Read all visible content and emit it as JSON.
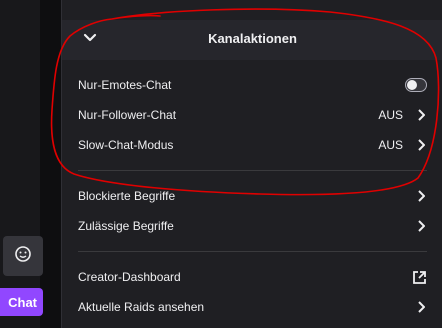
{
  "left": {
    "chat_button_label": "Chat"
  },
  "panel": {
    "header_title": "Kanalaktionen",
    "rows": [
      {
        "label": "Nur-Emotes-Chat",
        "type": "toggle",
        "on": false
      },
      {
        "label": "Nur-Follower-Chat",
        "value": "AUS",
        "type": "chevron"
      },
      {
        "label": "Slow-Chat-Modus",
        "value": "AUS",
        "type": "chevron"
      },
      {
        "label": "Blockierte Begriffe",
        "type": "chevron"
      },
      {
        "label": "Zulässige Begriffe",
        "type": "chevron"
      },
      {
        "label": "Creator-Dashboard",
        "type": "external"
      },
      {
        "label": "Aktuelle Raids ansehen",
        "type": "chevron"
      }
    ]
  },
  "colors": {
    "accent": "#9147ff",
    "annotation": "#e00000"
  }
}
